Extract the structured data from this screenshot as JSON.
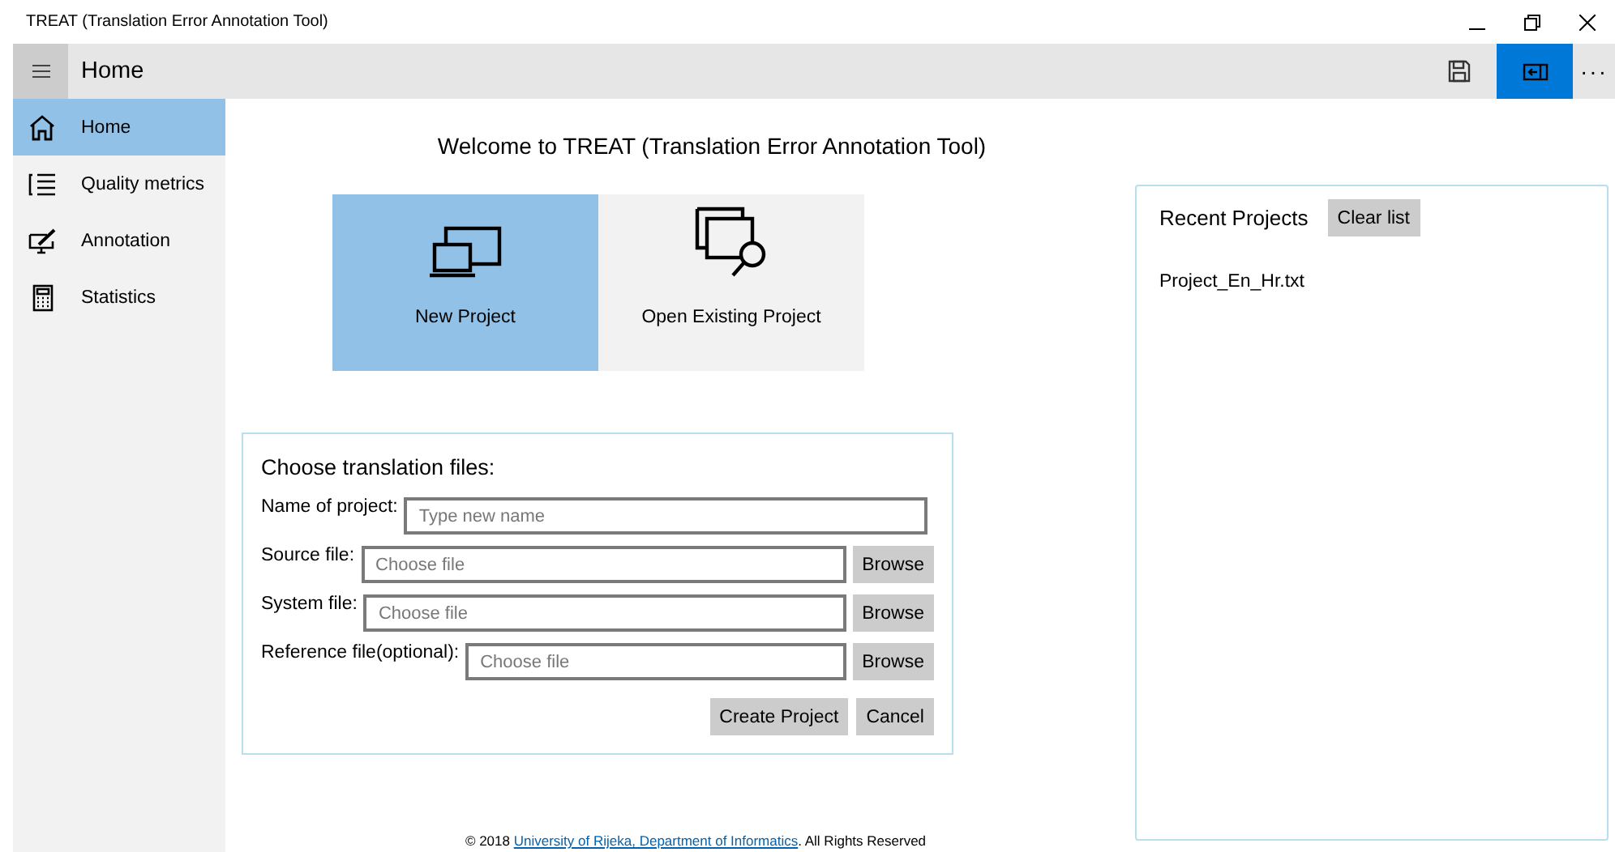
{
  "window": {
    "title": "TREAT (Translation Error Annotation Tool)"
  },
  "app_bar": {
    "title": "Home",
    "actions": [
      {
        "kind": "save",
        "active": false
      },
      {
        "kind": "panel",
        "active": true
      }
    ],
    "more": "···"
  },
  "sidebar": {
    "items": [
      {
        "label": "Home",
        "kind": "home",
        "selected": true
      },
      {
        "label": "Quality metrics",
        "kind": "list",
        "selected": false
      },
      {
        "label": "Annotation",
        "kind": "annotation",
        "selected": false
      },
      {
        "label": "Statistics",
        "kind": "calculator",
        "selected": false
      }
    ]
  },
  "welcome": "Welcome to TREAT (Translation Error Annotation Tool)",
  "tiles": [
    {
      "label": "New Project",
      "kind": "new",
      "selected": true
    },
    {
      "label": "Open Existing Project",
      "kind": "open",
      "selected": false
    }
  ],
  "form": {
    "title": "Choose translation files:",
    "rows": [
      {
        "label": "Name of project:",
        "placeholder": "Type new name"
      },
      {
        "label": "Source file:",
        "placeholder": "Choose file",
        "button": "Browse"
      },
      {
        "label": "System file:",
        "placeholder": "Choose file",
        "button": "Browse"
      },
      {
        "label": "Reference file(optional):",
        "placeholder": "Choose file",
        "button": "Browse"
      }
    ],
    "buttons": [
      "Create Project",
      "Cancel"
    ]
  },
  "recent": {
    "title": "Recent Projects",
    "clear_button": "Clear list",
    "items": [
      "Project_En_Hr.txt"
    ]
  },
  "footer": {
    "prefix": "© 2018 ",
    "link": "University of Rijeka, Department of Informatics",
    "suffix": ". All Rights Reserved"
  }
}
